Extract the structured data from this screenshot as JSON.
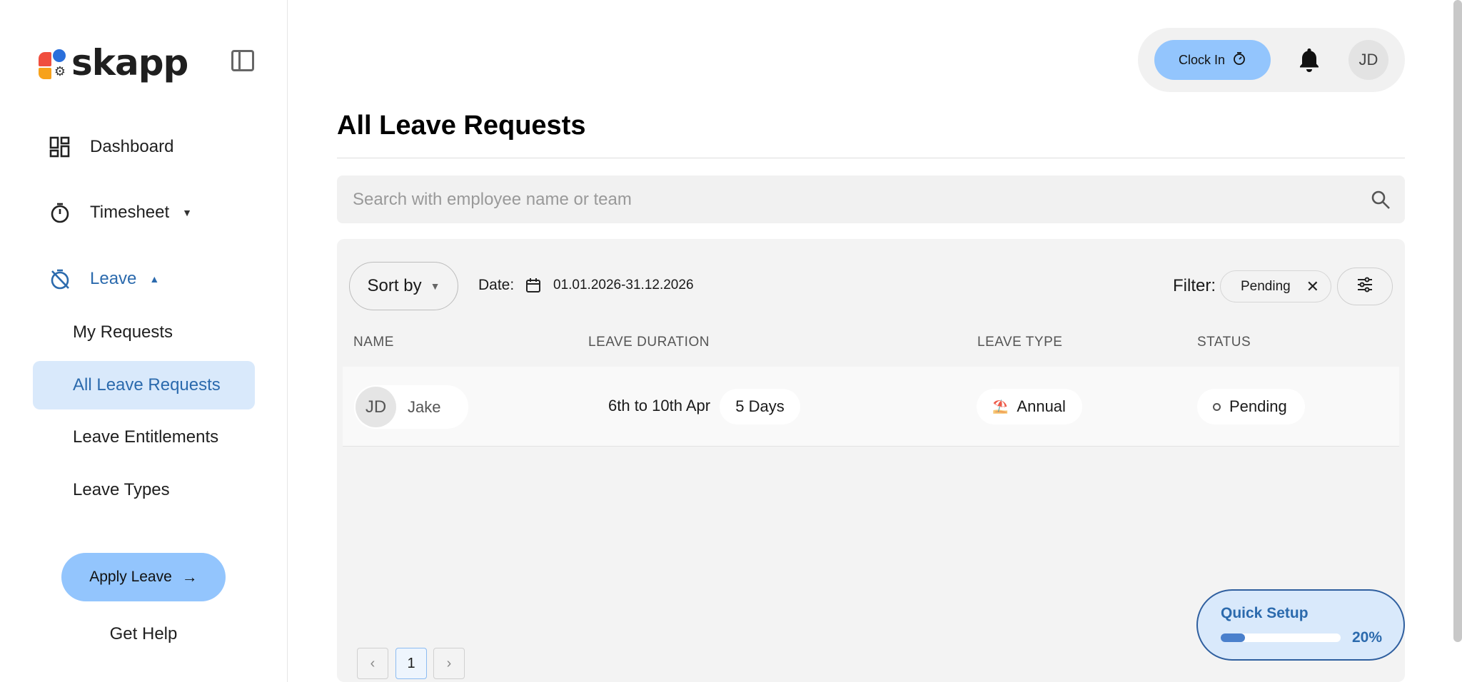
{
  "brand": {
    "name": "skapp"
  },
  "sidebar": {
    "nav": [
      {
        "label": "Dashboard"
      },
      {
        "label": "Timesheet"
      },
      {
        "label": "Leave"
      }
    ],
    "leave_sub": [
      {
        "label": "My Requests"
      },
      {
        "label": "All Leave Requests"
      },
      {
        "label": "Leave Entitlements"
      },
      {
        "label": "Leave Types"
      }
    ],
    "apply_label": "Apply Leave",
    "help_label": "Get Help"
  },
  "header": {
    "clock_in_label": "Clock In",
    "user_initials": "JD"
  },
  "page": {
    "title": "All Leave Requests",
    "search_placeholder": "Search with employee name or team"
  },
  "toolbar": {
    "sort_label": "Sort by",
    "date_label": "Date:",
    "date_range": "01.01.2026-31.12.2026",
    "filter_label": "Filter:",
    "filter_value": "Pending"
  },
  "table": {
    "columns": [
      "NAME",
      "LEAVE DURATION",
      "LEAVE TYPE",
      "STATUS"
    ],
    "rows": [
      {
        "initials": "JD",
        "name": "Jake",
        "duration": "6th to 10th Apr",
        "days": "5 Days",
        "type_icon": "⛱️",
        "type": "Annual",
        "status": "Pending"
      }
    ]
  },
  "pagination": {
    "current": "1"
  },
  "quick_setup": {
    "title": "Quick Setup",
    "percent_label": "20%",
    "progress": 0.2
  },
  "colors": {
    "accent": "#93c5fd",
    "active_text": "#2b6aad",
    "selected_bg": "#d9e9fb"
  }
}
